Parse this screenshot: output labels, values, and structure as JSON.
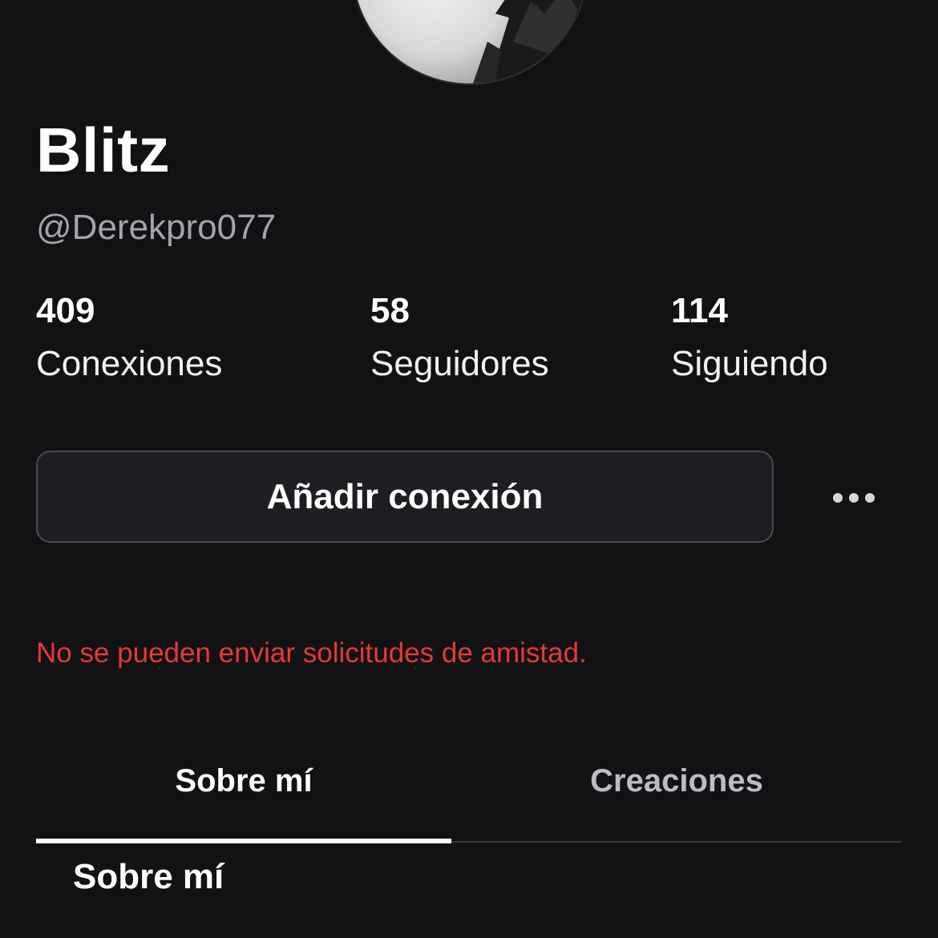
{
  "profile": {
    "display_name": "Blitz",
    "username": "@Derekpro077"
  },
  "stats": [
    {
      "value": "409",
      "label": "Conexiones"
    },
    {
      "value": "58",
      "label": "Seguidores"
    },
    {
      "value": "114",
      "label": "Siguiendo"
    }
  ],
  "actions": {
    "add_connection_label": "Añadir conexión",
    "more_icon": "more-horizontal-icon"
  },
  "error_message": "No se pueden enviar solicitudes de amistad.",
  "tabs": [
    {
      "label": "Sobre mí",
      "selected": true
    },
    {
      "label": "Creaciones",
      "selected": false
    }
  ],
  "about": {
    "heading": "Sobre mí"
  },
  "colors": {
    "background": "#121215",
    "error": "#e53935",
    "muted_text": "#a3a3aa",
    "button_background": "#1e1e22",
    "button_border": "#4a4a50"
  }
}
